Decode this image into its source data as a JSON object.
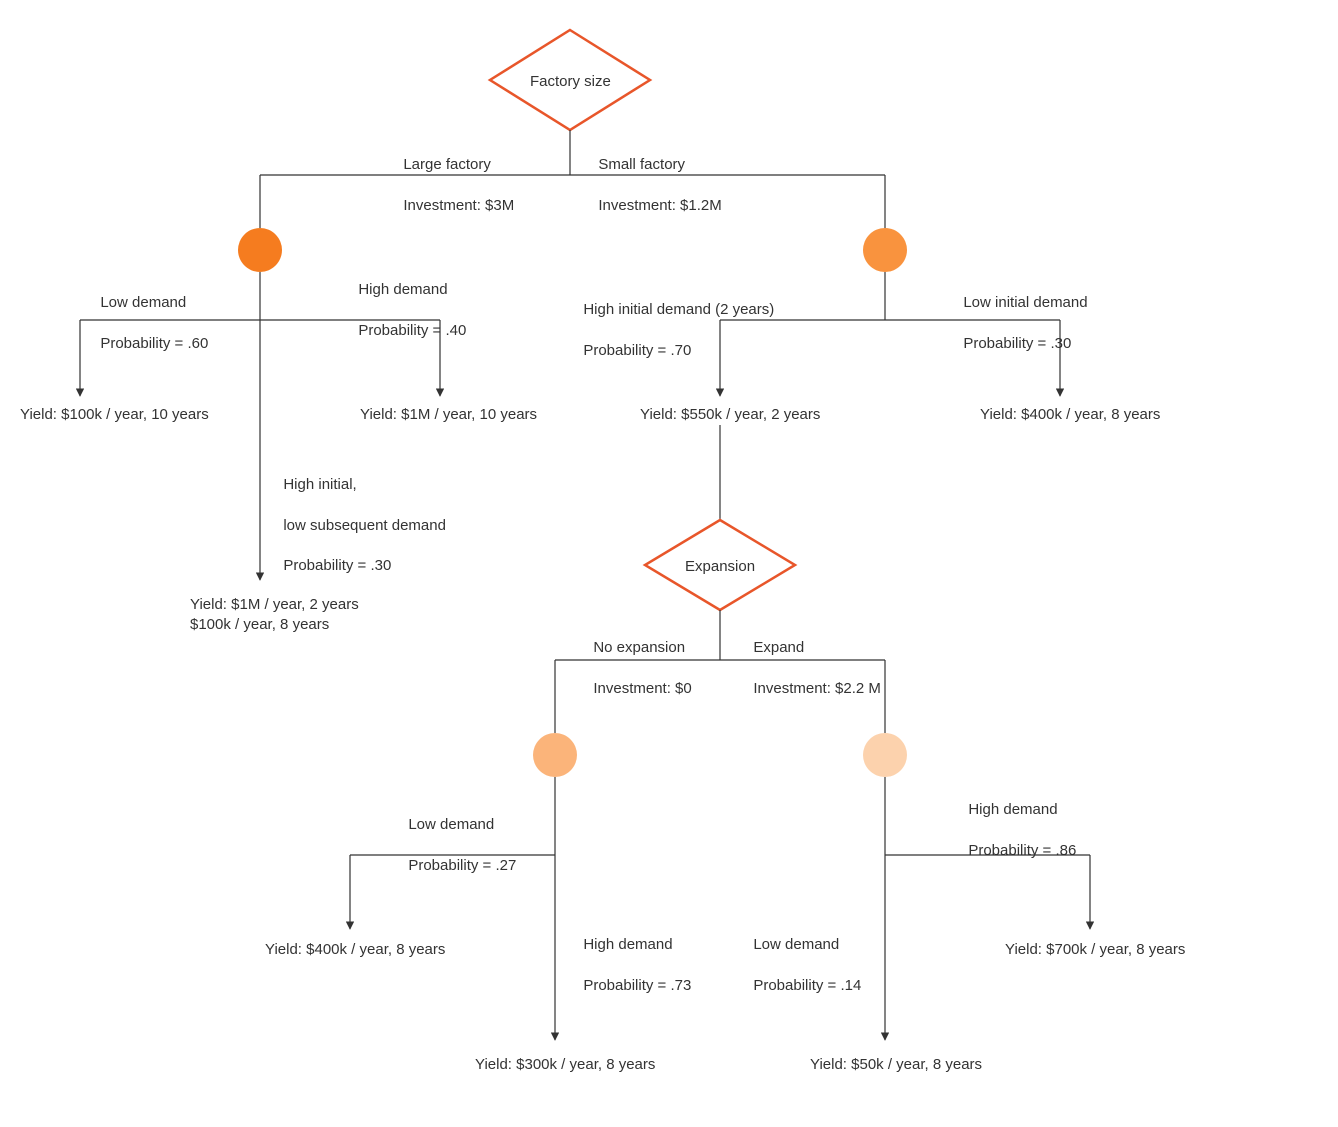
{
  "colors": {
    "stroke": "#333333",
    "diamond_stroke": "#e8562a",
    "diamond_fill": "#ffffff",
    "circle1": "#f57c1f",
    "circle2": "#f9933e",
    "circle3": "#fbb47a",
    "circle4": "#fcd2ad"
  },
  "nodes": {
    "root": {
      "label": "Factory size"
    },
    "expansion": {
      "label": "Expansion"
    }
  },
  "edges": {
    "root_left": {
      "l1": "Large factory",
      "l2": "Investment: $3M"
    },
    "root_right": {
      "l1": "Small factory",
      "l2": "Investment: $1.2M"
    },
    "lf_low": {
      "l1": "Low demand",
      "l2": "Probability = .60"
    },
    "lf_high": {
      "l1": "High demand",
      "l2": "Probability = .40"
    },
    "lf_mid": {
      "l1": "High initial,",
      "l2": "low subsequent demand",
      "l3": "Probability = .30"
    },
    "sf_left": {
      "l1": "High initial demand (2 years)",
      "l2": "Probability = .70"
    },
    "sf_right": {
      "l1": "Low initial demand",
      "l2": "Probability = .30"
    },
    "exp_left": {
      "l1": "No expansion",
      "l2": "Investment: $0"
    },
    "exp_right": {
      "l1": "Expand",
      "l2": "Investment: $2.2 M"
    },
    "noexp_low": {
      "l1": "Low demand",
      "l2": "Probability = .27"
    },
    "noexp_high": {
      "l1": "High demand",
      "l2": "Probability = .73"
    },
    "exp_low": {
      "l1": "Low demand",
      "l2": "Probability = .14"
    },
    "exp_high": {
      "l1": "High demand",
      "l2": "Probability = .86"
    }
  },
  "leaves": {
    "lf_low_yield": "Yield: $100k / year, 10 years",
    "lf_high_yield": "Yield: $1M / year, 10 years",
    "lf_mid_yield": "Yield: $1M / year, 2 years\n$100k / year, 8 years",
    "sf_left_yield": "Yield: $550k / year, 2 years",
    "sf_right_yield": "Yield: $400k / year, 8 years",
    "noexp_low_yield": "Yield: $400k / year, 8 years",
    "noexp_high_yield": "Yield: $300k / year, 8 years",
    "exp_low_yield": "Yield: $50k / year, 8 years",
    "exp_high_yield": "Yield: $700k / year, 8 years"
  }
}
